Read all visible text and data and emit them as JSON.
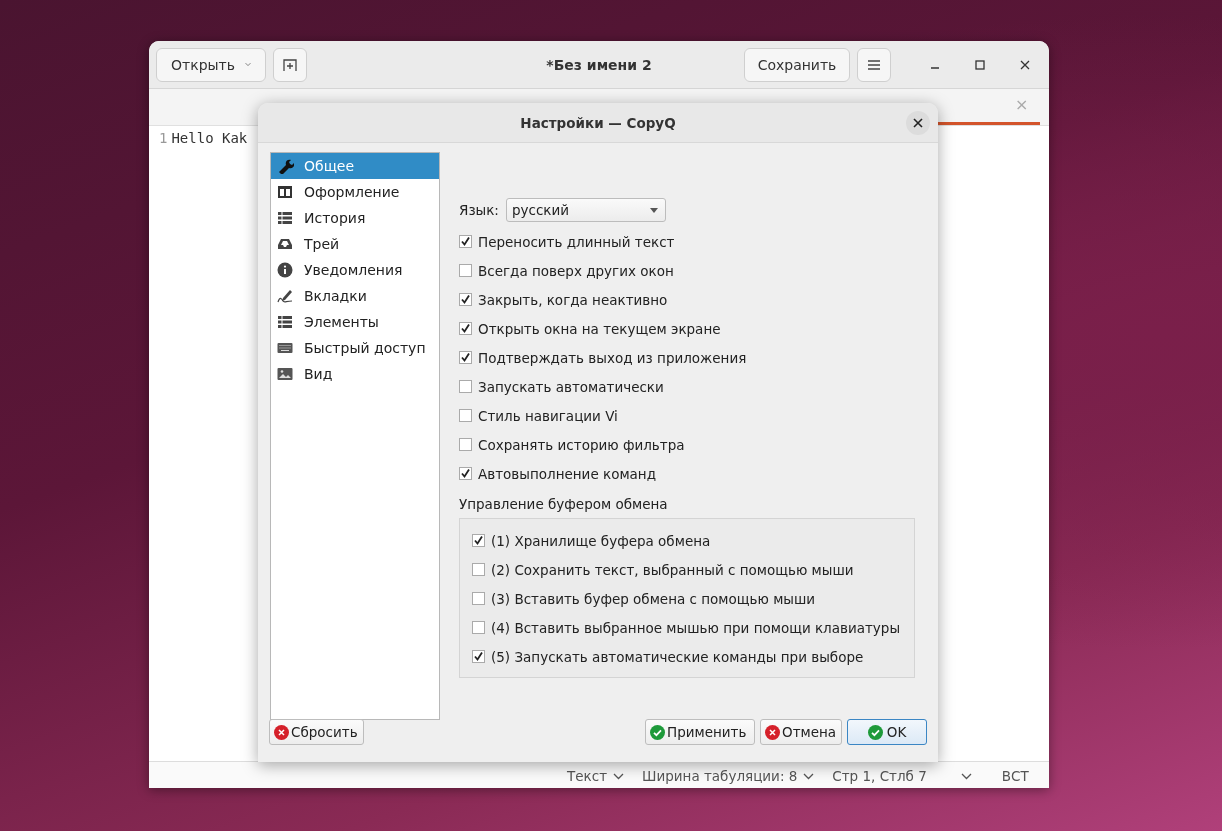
{
  "editor": {
    "open_button": "Открыть",
    "title": "*Без имени 2",
    "save_button": "Сохранить",
    "tab_close": "×",
    "line_number": "1",
    "text": "Hello Kak",
    "status": [
      {
        "label": "Текст",
        "dropdown": true
      },
      {
        "label": "Ширина табуляции: 8",
        "dropdown": true
      },
      {
        "label": "Стр 1, Стлб 7",
        "dropdown": true
      },
      {
        "label": "ВСТ",
        "dropdown": false
      }
    ]
  },
  "dialog": {
    "title": "Настройки — CopyQ",
    "sidebar": [
      {
        "label": "Общее",
        "selected": true
      },
      {
        "label": "Оформление",
        "selected": false
      },
      {
        "label": "История",
        "selected": false
      },
      {
        "label": "Трей",
        "selected": false
      },
      {
        "label": "Уведомления",
        "selected": false
      },
      {
        "label": "Вкладки",
        "selected": false
      },
      {
        "label": "Элементы",
        "selected": false
      },
      {
        "label": "Быстрый доступ",
        "selected": false
      },
      {
        "label": "Вид",
        "selected": false
      }
    ],
    "language": {
      "label": "Язык:",
      "value": "русский"
    },
    "options": [
      {
        "label": "Переносить длинный текст",
        "checked": true
      },
      {
        "label": "Всегда поверх других окон",
        "checked": false
      },
      {
        "label": "Закрыть, когда неактивно",
        "checked": true
      },
      {
        "label": "Открыть окна на текущем экране",
        "checked": true
      },
      {
        "label": "Подтверждать выход из приложения",
        "checked": true
      },
      {
        "label": "Запускать автоматически",
        "checked": false
      },
      {
        "label": "Стиль навигации Vi",
        "checked": false
      },
      {
        "label": "Сохранять историю фильтра",
        "checked": false
      },
      {
        "label": "Автовыполнение команд",
        "checked": true
      }
    ],
    "clipboard_group": {
      "title": "Управление буфером обмена",
      "options": [
        {
          "label": "(1) Хранилище буфера обмена",
          "checked": true
        },
        {
          "label": "(2) Сохранить текст, выбранный с помощью мыши",
          "checked": false
        },
        {
          "label": "(3) Вставить буфер обмена с помощью мыши",
          "checked": false
        },
        {
          "label": "(4) Вставить выбранное мышью при помощи клавиатуры",
          "checked": false
        },
        {
          "label": "(5) Запускать автоматические команды при выборе",
          "checked": true
        }
      ]
    },
    "buttons": [
      {
        "label": "Сбросить",
        "kind": "reject",
        "default": false
      },
      {
        "label": "Применить",
        "kind": "accept",
        "default": false
      },
      {
        "label": "Отмена",
        "kind": "reject",
        "default": false
      },
      {
        "label": "OK",
        "kind": "accept",
        "default": true
      }
    ]
  }
}
